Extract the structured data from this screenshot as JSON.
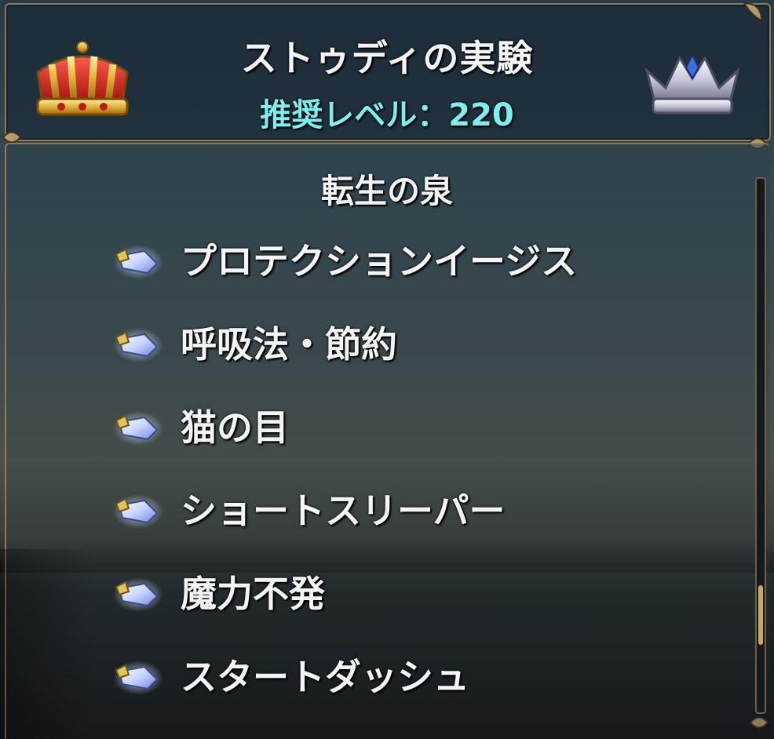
{
  "header": {
    "title": "ストゥディの実験",
    "recommended_level": "推奨レベル：220",
    "left_icon": "gold-crown-icon",
    "right_icon": "silver-crown-icon"
  },
  "list": {
    "section_title": "転生の泉",
    "item_icon": "crystal-skill-icon",
    "items": [
      {
        "label": "プロテクションイージス"
      },
      {
        "label": "呼吸法・節約"
      },
      {
        "label": "猫の目"
      },
      {
        "label": "ショートスリーパー"
      },
      {
        "label": "魔力不発"
      },
      {
        "label": "スタートダッシュ"
      }
    ]
  },
  "colors": {
    "title_text": "#f4f4f4",
    "level_text": "#7cf0f0",
    "frame": "#8c7a5c",
    "scroll_thumb": "#c9a75c"
  },
  "scroll_position": 0.78
}
